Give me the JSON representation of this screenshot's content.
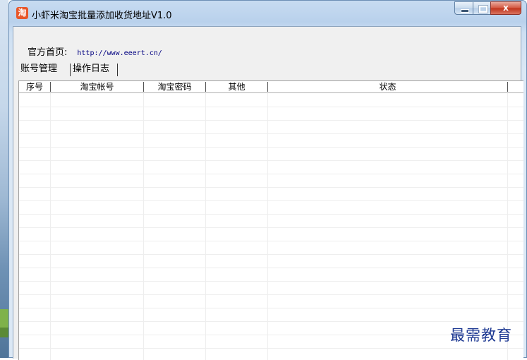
{
  "window": {
    "icon_glyph": "淘",
    "title": "小虾米淘宝批量添加收货地址V1.0",
    "close_glyph": "x"
  },
  "homepage": {
    "label": "官方首页:",
    "url": "http://www.eeert.cn/"
  },
  "tabs": [
    {
      "label": "账号管理"
    },
    {
      "label": "操作日志"
    }
  ],
  "table": {
    "columns": [
      "序号",
      "淘宝帐号",
      "淘宝密码",
      "其他",
      "状态"
    ]
  },
  "watermark": "最需教育"
}
